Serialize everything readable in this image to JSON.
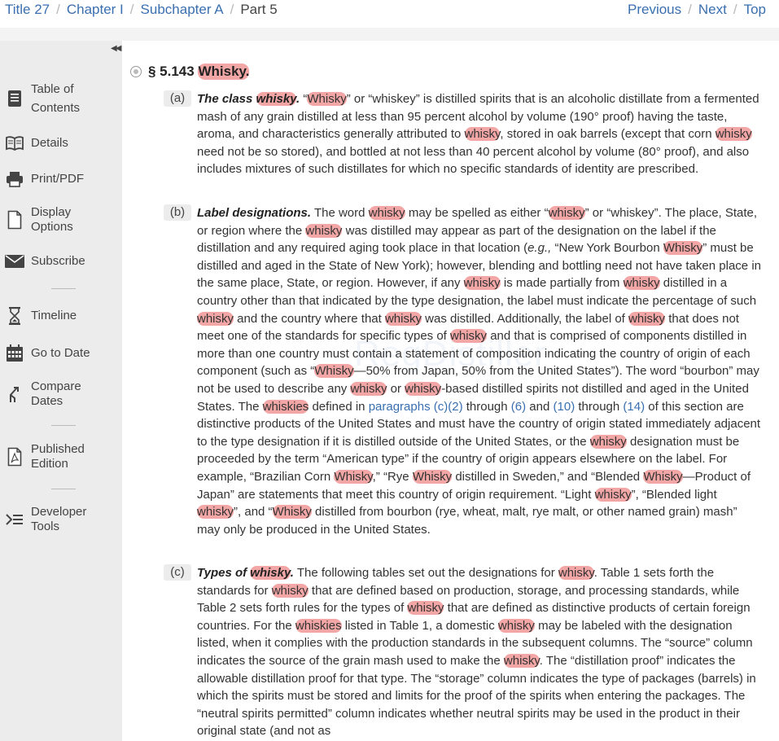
{
  "breadcrumb": {
    "title": "Title 27",
    "chapter": "Chapter I",
    "subchapter": "Subchapter A",
    "part": "Part 5"
  },
  "nav": {
    "previous": "Previous",
    "next": "Next",
    "top": "Top"
  },
  "sidebar": {
    "toc": "Table of Contents",
    "details": "Details",
    "print": "Print/PDF",
    "display": "Display Options",
    "subscribe": "Subscribe",
    "timeline": "Timeline",
    "go_to_date": "Go to Date",
    "compare": "Compare Dates",
    "published": "Published Edition",
    "developer": "Developer Tools"
  },
  "section": {
    "number": "§ 5.143",
    "title": "Whisky."
  },
  "paragraphs": {
    "a": {
      "label": "(a)",
      "heading": "The class whisky.",
      "text": "“Whisky” or “whiskey” is distilled spirits that is an alcoholic distillate from a fermented mash of any grain distilled at less than 95 percent alcohol by volume (190° proof) having the taste, aroma, and characteristics generally attributed to whisky, stored in oak barrels (except that corn whisky need not be so stored), and bottled at not less than 40 percent alcohol by volume (80° proof), and also includes mixtures of such distillates for which no specific standards of identity are prescribed."
    },
    "b": {
      "label": "(b)",
      "heading": "Label designations.",
      "text1": "The word whisky may be spelled as either “whisky” or “whiskey”. The place, State, or region where the whisky was distilled may appear as part of the designation on the label if the distillation and any required aging took place in that location (",
      "eg": "e.g.,",
      "text2": " “New York Bourbon Whisky” must be distilled and aged in the State of New York); however, blending and bottling need not have taken place in the same place, State, or region. However, if any whisky is made partially from whisky distilled in a country other than that indicated by the type designation, the label must indicate the percentage of such whisky and the country where that whisky was distilled. Additionally, the label of whisky that does not meet one of the standards for specific types of whisky and that is comprised of components distilled in more than one country must contain a statement of composition indicating the country of origin of each component (such as “Whisky—50% from Japan, 50% from the United States”). The word “bourbon” may not be used to describe any whisky or whisky-based distilled spirits not distilled and aged in the United States. The whiskies defined in ",
      "link1": "paragraphs (c)(2)",
      "mid1": " through ",
      "link2": "(6)",
      "mid2": " and ",
      "link3": "(10)",
      "mid3": " through ",
      "link4": "(14)",
      "text3": " of this section are distinctive products of the United States and must have the country of origin stated immediately adjacent to the type designation if it is distilled outside of the United States, or the whisky designation must be proceeded by the term “American type” if the country of origin appears elsewhere on the label. For example, “Brazilian Corn Whisky,” “Rye Whisky distilled in Sweden,” and “Blended Whisky—Product of Japan” are statements that meet this country of origin requirement. “Light whisky”, “Blended light whisky”, and “Whisky distilled from bourbon (rye, wheat, malt, rye malt, or other named grain) mash” may only be produced in the United States."
    },
    "c": {
      "label": "(c)",
      "heading": "Types of whisky.",
      "text": "The following tables set out the designations for whisky. Table 1 sets forth the standards for whisky that are defined based on production, storage, and processing standards, while Table 2 sets forth rules for the types of whisky that are defined as distinctive products of certain foreign countries. For the whiskies listed in Table 1, a domestic whisky may be labeled with the designation listed, when it complies with the production standards in the subsequent columns. The “source” column indicates the source of the grain mash used to make the whisky. The “distillation proof” indicates the allowable distillation proof for that type. The “storage” column indicates the type of packages (barrels) in which the spirits must be stored and limits for the proof of the spirits when entering the packages. The “neutral spirits permitted” column indicates whether neutral spirits may be used in the product in their original state (and not as"
    }
  },
  "watermark": "RegDistiller"
}
